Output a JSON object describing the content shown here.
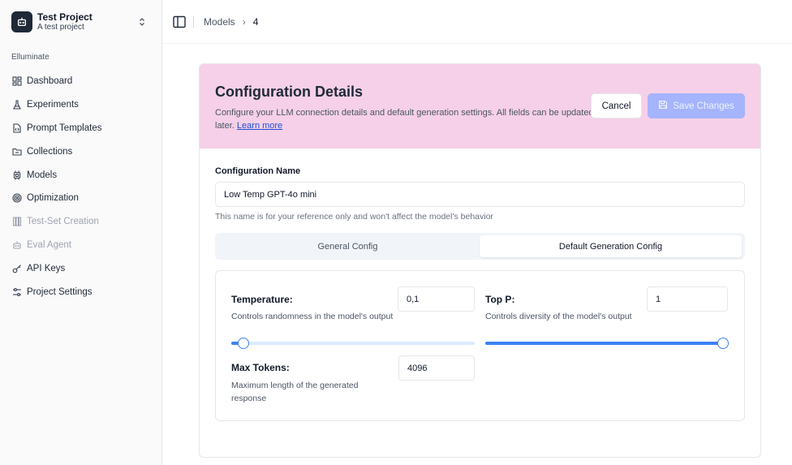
{
  "project": {
    "name": "Test Project",
    "subtitle": "A test project"
  },
  "sidebar": {
    "section_label": "Elluminate",
    "items": [
      {
        "label": "Dashboard",
        "icon": "dashboard-icon"
      },
      {
        "label": "Experiments",
        "icon": "flask-icon"
      },
      {
        "label": "Prompt Templates",
        "icon": "file-code-icon"
      },
      {
        "label": "Collections",
        "icon": "folder-icon"
      },
      {
        "label": "Models",
        "icon": "cpu-icon"
      },
      {
        "label": "Optimization",
        "icon": "target-icon"
      },
      {
        "label": "Test-Set Creation",
        "icon": "columns-icon",
        "disabled": true
      },
      {
        "label": "Eval Agent",
        "icon": "bot-icon",
        "disabled": true
      },
      {
        "label": "API Keys",
        "icon": "key-icon"
      },
      {
        "label": "Project Settings",
        "icon": "sliders-icon"
      }
    ]
  },
  "breadcrumb": {
    "parent": "Models",
    "current": "4"
  },
  "card": {
    "title": "Configuration Details",
    "description": "Configure your LLM connection details and default generation settings. All fields can be updated later.",
    "learn_more": "Learn more",
    "cancel_label": "Cancel",
    "save_label": "Save Changes"
  },
  "config_name": {
    "label": "Configuration Name",
    "value": "Low Temp GPT-4o mini",
    "help": "This name is for your reference only and won't affect the model's behavior"
  },
  "tabs": {
    "general": "General Config",
    "default_generation": "Default Generation Config",
    "active": "default_generation"
  },
  "generation": {
    "temperature": {
      "label": "Temperature:",
      "desc": "Controls randomness in the model's output",
      "value": "0,1",
      "slider_fraction": 0.05
    },
    "top_p": {
      "label": "Top P:",
      "desc": "Controls diversity of the model's output",
      "value": "1",
      "slider_fraction": 1.0
    },
    "max_tokens": {
      "label": "Max Tokens:",
      "desc": "Maximum length of the generated response",
      "value": "4096"
    }
  },
  "colors": {
    "header_bg": "#f5d0e8",
    "accent": "#3b82f6",
    "save_disabled": "#a5b4fc"
  }
}
